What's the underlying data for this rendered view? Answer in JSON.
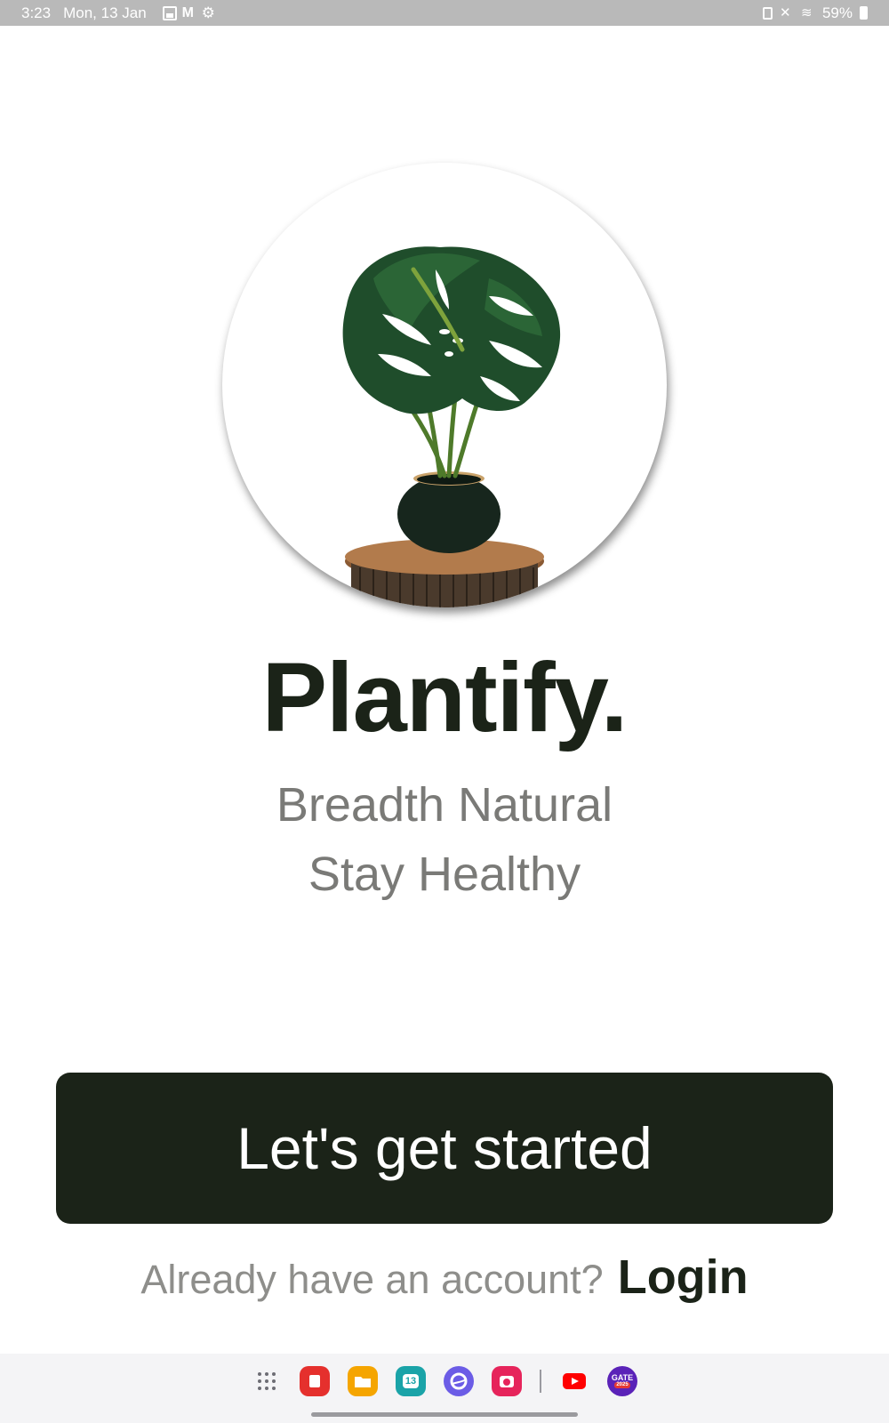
{
  "status_bar": {
    "time": "3:23",
    "date": "Mon, 13 Jan",
    "battery": "59%"
  },
  "app": {
    "title": "Plantify.",
    "tagline_line1": "Breadth Natural",
    "tagline_line2": "Stay Healthy"
  },
  "cta": {
    "label": "Let's get started"
  },
  "login": {
    "prompt": "Already have an account?",
    "link": "Login"
  },
  "taskbar": {
    "calendar_day": "13",
    "gate_label": "GATE",
    "gate_year": "2025"
  },
  "colors": {
    "primary_dark": "#1b2318",
    "muted_text": "#7a7a77",
    "status_bar_bg": "#b9b9b9"
  }
}
